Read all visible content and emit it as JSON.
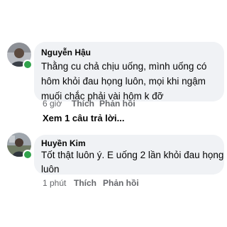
{
  "comments": [
    {
      "author": "Nguyễn Hậu",
      "lines": [
        "Thằng cu chả chịu uống, mình uống có",
        "hôm khỏi đau họng luôn, mọi khi ngậm",
        "muối chắc phải vài hôm k đỡ"
      ],
      "time": "6 giờ",
      "like_label": "Thích",
      "reply_label": "Phản hồi",
      "online": true,
      "avatar_icon": "user-avatar"
    },
    {
      "author": "Huyền Kim",
      "lines": [
        "Tốt thật luôn ý. E uống 2 lần khỏi đau họng",
        "luôn"
      ],
      "time": "1 phút",
      "like_label": "Thích",
      "reply_label": "Phản hồi",
      "online": true,
      "avatar_icon": "user-avatar"
    }
  ],
  "view_replies_label": "Xem 1 câu trả lời...",
  "colors": {
    "bubble": "#f0f2f5",
    "text": "#050505",
    "meta": "#65676b",
    "online": "#31a24c"
  }
}
